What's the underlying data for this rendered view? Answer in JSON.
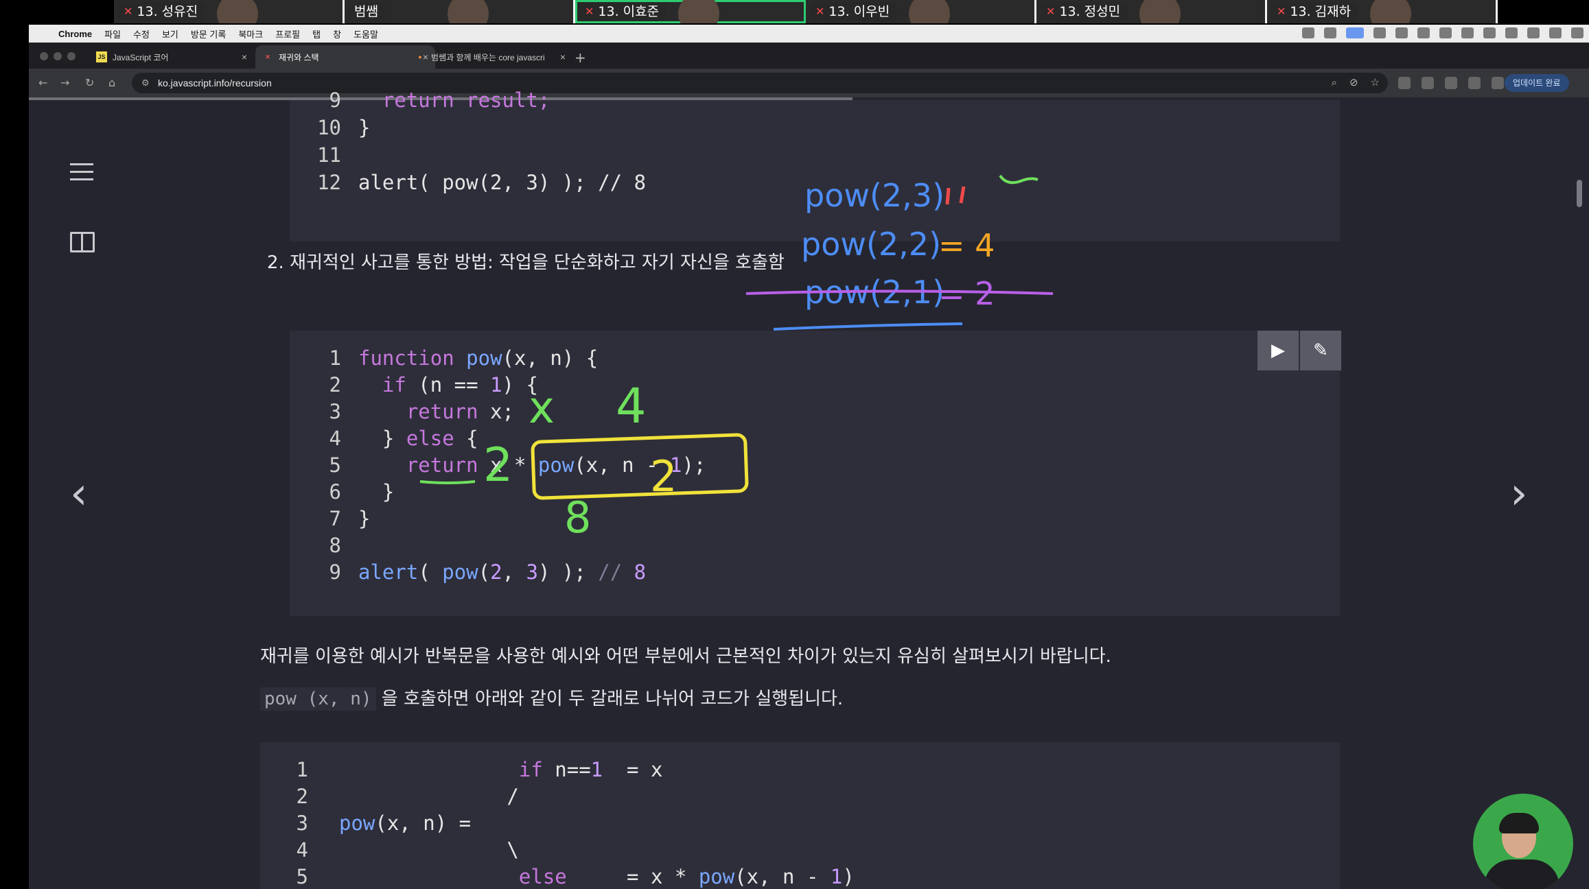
{
  "participants": [
    {
      "name": "13. 성유진"
    },
    {
      "name": "범쌤"
    },
    {
      "name": "13. 이효준"
    },
    {
      "name": "13. 이우빈"
    },
    {
      "name": "13. 정성민"
    },
    {
      "name": "13. 김재하"
    }
  ],
  "menubar": {
    "app": "Chrome",
    "items": [
      "파일",
      "수정",
      "보기",
      "방문 기록",
      "북마크",
      "프로필",
      "탭",
      "창",
      "도움말"
    ]
  },
  "tabs": [
    {
      "title": "JavaScript 코어",
      "favicon": "JS",
      "active": false
    },
    {
      "title": "재귀와 스택",
      "favicon": "js-red",
      "active": true
    },
    {
      "title": "범쌤과 함께 배우는 core javascri",
      "favicon": "fox",
      "active": false
    }
  ],
  "address": {
    "url": "ko.javascript.info/recursion"
  },
  "update_button": {
    "label": "업데이트 완료"
  },
  "code_top": {
    "rows": [
      {
        "n": "9",
        "code": "  return result;"
      },
      {
        "n": "10",
        "code": "}"
      },
      {
        "n": "11",
        "code": ""
      },
      {
        "n": "12",
        "code": "alert( pow(2, 3) ); // 8"
      }
    ]
  },
  "section_heading": "2. 재귀적인 사고를 통한 방법: 작업을 단순화하고 자기 자신을 호출함",
  "code_main": {
    "rows": [
      {
        "n": "1",
        "code": "function pow(x, n) {"
      },
      {
        "n": "2",
        "code": "  if (n == 1) {"
      },
      {
        "n": "3",
        "code": "    return x;"
      },
      {
        "n": "4",
        "code": "  } else {"
      },
      {
        "n": "5",
        "code": "    return x * pow(x, n - 1);"
      },
      {
        "n": "6",
        "code": "  }"
      },
      {
        "n": "7",
        "code": "}"
      },
      {
        "n": "8",
        "code": ""
      },
      {
        "n": "9",
        "code": "alert( pow(2, 3) ); // 8"
      }
    ]
  },
  "paragraph1": "재귀를 이용한 예시가 반복문을 사용한 예시와 어떤 부분에서 근본적인 차이가 있는지 유심히 살펴보시기 바랍니다.",
  "paragraph2": {
    "code": "pow (x, n)",
    "text": " 을 호출하면 아래와 같이 두 갈래로 나뉘어 코드가 실행됩니다."
  },
  "code_bottom": {
    "rows": [
      {
        "n": "1",
        "code": "               if n==1  = x"
      },
      {
        "n": "2",
        "code": "              /"
      },
      {
        "n": "3",
        "code": "pow(x, n) ="
      },
      {
        "n": "4",
        "code": "              \\"
      },
      {
        "n": "5",
        "code": "               else     = x * pow(x, n - 1)"
      }
    ]
  },
  "annotations": {
    "line1": "pow(2,3)",
    "line2": "pow(2,2)",
    "line2_result": "= 4",
    "line3": "pow(2,1)",
    "line3_result": "= 2",
    "mark_four": "4",
    "mark_two": "2",
    "mark_eight": "8",
    "mark_x": "x"
  },
  "colors": {
    "ink_blue": "#4d8df6",
    "ink_orange": "#f5a623",
    "ink_purple": "#b860e8",
    "ink_green": "#6fe05c",
    "ink_yellow": "#f0e23a",
    "ink_red": "#f04a4a"
  }
}
